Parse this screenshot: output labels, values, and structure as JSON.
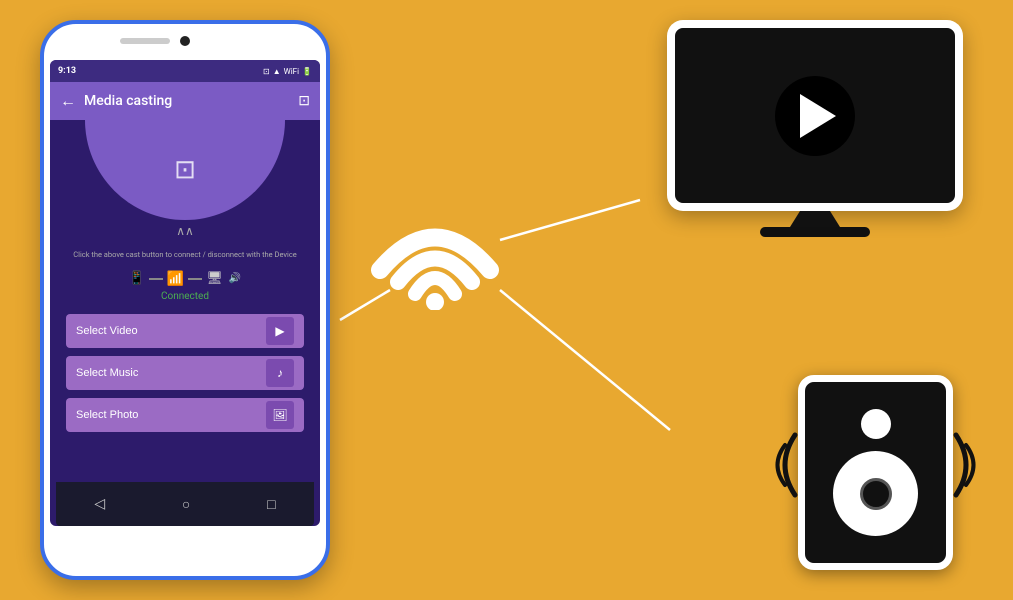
{
  "background_color": "#E8A830",
  "phone": {
    "status_bar": {
      "time": "9:13",
      "icons": "◈ ▲ WiFi Batt"
    },
    "app_bar": {
      "title": "Media casting",
      "back_icon": "←",
      "cast_icon": "⊡"
    },
    "instruction": "Click the above cast button to connect / disconnect with the Device",
    "connection_status": "Connected",
    "buttons": [
      {
        "label": "Select Video",
        "icon": "▶"
      },
      {
        "label": "Select Music",
        "icon": "♪"
      },
      {
        "label": "Select Photo",
        "icon": "🖼"
      }
    ]
  },
  "wifi": {
    "color": "#ffffff"
  },
  "tv": {
    "play_icon": "▶"
  },
  "speaker": {
    "label": "speaker"
  }
}
